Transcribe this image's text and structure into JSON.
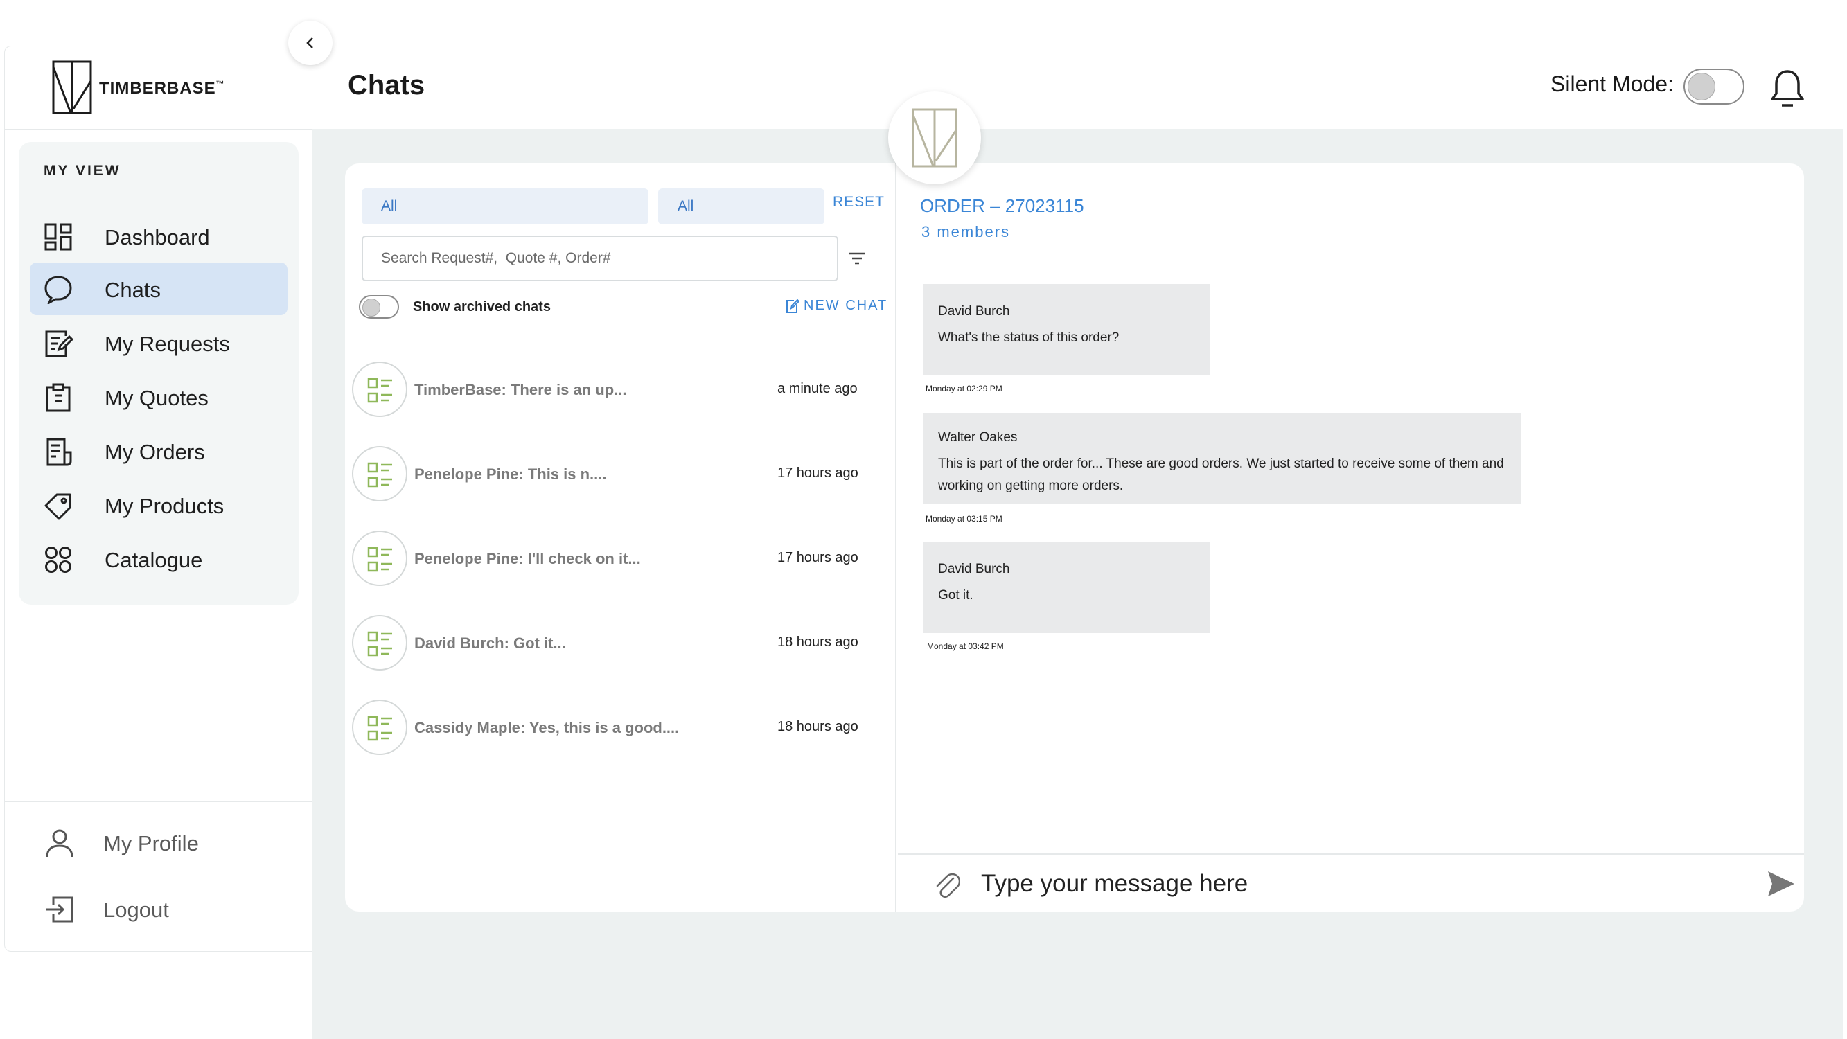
{
  "brand": {
    "name": "TIMBERBASE",
    "trademark": "™",
    "accent": "#3b86d6",
    "logo_green": "#8fb85a"
  },
  "sidebar": {
    "section_title": "MY VIEW",
    "items": [
      {
        "label": "Dashboard",
        "icon": "dashboard-icon",
        "active": false
      },
      {
        "label": "Chats",
        "icon": "chat-bubble-icon",
        "active": true
      },
      {
        "label": "My Requests",
        "icon": "request-edit-icon",
        "active": false
      },
      {
        "label": "My Quotes",
        "icon": "clipboard-icon",
        "active": false
      },
      {
        "label": "My Orders",
        "icon": "receipt-icon",
        "active": false
      },
      {
        "label": "My Products",
        "icon": "tag-icon",
        "active": false
      },
      {
        "label": "Catalogue",
        "icon": "grid-circles-icon",
        "active": false
      }
    ],
    "bottom": [
      {
        "label": "My Profile",
        "icon": "user-icon"
      },
      {
        "label": "Logout",
        "icon": "logout-icon"
      }
    ]
  },
  "header": {
    "title": "Chats",
    "silent_mode_label": "Silent Mode:",
    "silent_mode_on": false
  },
  "chat_list": {
    "filter_1": "All",
    "filter_2": "All",
    "reset_label": "RESET",
    "search_placeholder": "Search Request#,  Quote #, Order#",
    "show_archived_label": "Show archived chats",
    "show_archived_on": false,
    "new_chat_label": "NEW CHAT",
    "chats": [
      {
        "preview": "TimberBase: There is an up...",
        "time": "a minute ago"
      },
      {
        "preview": "Penelope Pine: This is n....",
        "time": "17 hours ago"
      },
      {
        "preview": "Penelope Pine: I'll check on it...",
        "time": "17 hours ago"
      },
      {
        "preview": "David Burch: Got it...",
        "time": "18 hours ago"
      },
      {
        "preview": "Cassidy Maple: Yes, this is a good....",
        "time": "18 hours ago"
      }
    ]
  },
  "conversation": {
    "title": "ORDER – 27023115",
    "members": "3 members",
    "messages": [
      {
        "author": "David Burch",
        "text": "What's the status of this order?",
        "time": "Monday at 02:29 PM"
      },
      {
        "author": "Walter Oakes",
        "text": "This is part of the order for... These are good orders. We just started to receive some of them and working on getting more orders.",
        "time": "Monday at 03:15 PM"
      },
      {
        "author": "David Burch",
        "text": "Got it.",
        "time": "Monday at 03:42 PM"
      }
    ],
    "composer_placeholder": "Type your message here"
  }
}
